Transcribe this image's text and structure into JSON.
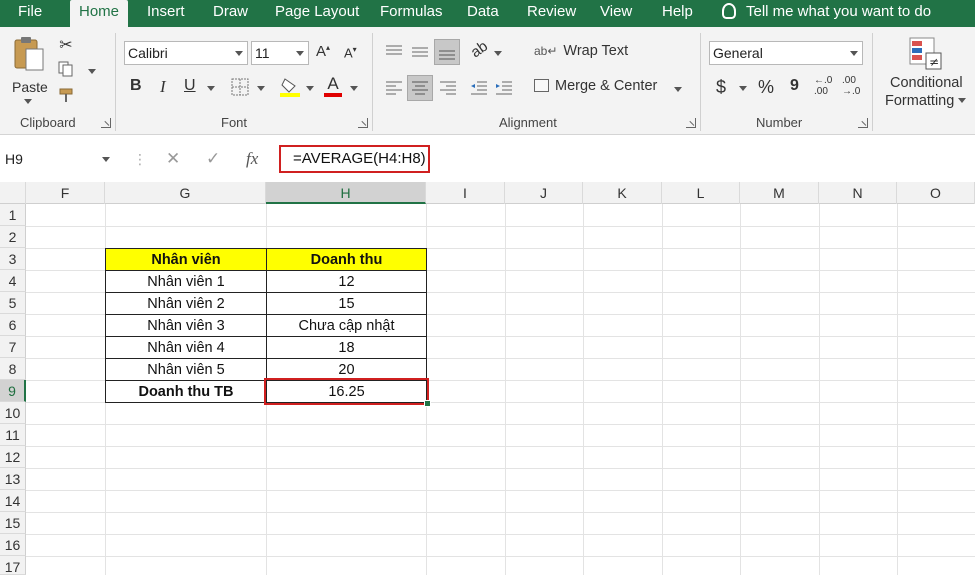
{
  "tabs": [
    {
      "label": "File"
    },
    {
      "label": "Home"
    },
    {
      "label": "Insert"
    },
    {
      "label": "Draw"
    },
    {
      "label": "Page Layout"
    },
    {
      "label": "Formulas"
    },
    {
      "label": "Data"
    },
    {
      "label": "Review"
    },
    {
      "label": "View"
    },
    {
      "label": "Help"
    }
  ],
  "active_tab": "Home",
  "tell_me": "Tell me what you want to do",
  "ribbon": {
    "clipboard": {
      "paste": "Paste",
      "label": "Clipboard"
    },
    "font": {
      "name": "Calibri",
      "size": "11",
      "bold": "B",
      "italic": "I",
      "underline": "U",
      "font_color_glyph": "A",
      "label": "Font"
    },
    "alignment": {
      "wrap_text": "Wrap Text",
      "merge_center": "Merge & Center",
      "label": "Alignment"
    },
    "number": {
      "format": "General",
      "currency": "$",
      "percent": "%",
      "comma": "9",
      "inc_decimal": "←.0\n.00",
      "dec_decimal": ".00\n→.0",
      "label": "Number"
    },
    "styles": {
      "conditional_line1": "Conditional",
      "conditional_line2": "Formatting"
    }
  },
  "formula_bar": {
    "name_box": "H9",
    "cancel": "✕",
    "enter": "✓",
    "fx": "fx",
    "formula": "=AVERAGE(H4:H8)"
  },
  "columns": [
    "F",
    "G",
    "H",
    "I",
    "J",
    "K",
    "L",
    "M",
    "N",
    "O"
  ],
  "rows": [
    "1",
    "2",
    "3",
    "4",
    "5",
    "6",
    "7",
    "8",
    "9",
    "10",
    "11",
    "12",
    "13",
    "14",
    "15",
    "16",
    "17"
  ],
  "table": {
    "headers": [
      "Nhân viên",
      "Doanh thu"
    ],
    "rows": [
      [
        "Nhân viên 1",
        "12"
      ],
      [
        "Nhân viên 2",
        "15"
      ],
      [
        "Nhân viên 3",
        "Chưa cập nhật"
      ],
      [
        "Nhân viên 4",
        "18"
      ],
      [
        "Nhân viên 5",
        "20"
      ]
    ],
    "total_label": "Doanh thu TB",
    "total_value": "16.25"
  },
  "colors": {
    "excel_green": "#217346",
    "highlight_red": "#d02020",
    "header_yellow": "#ffff00"
  }
}
